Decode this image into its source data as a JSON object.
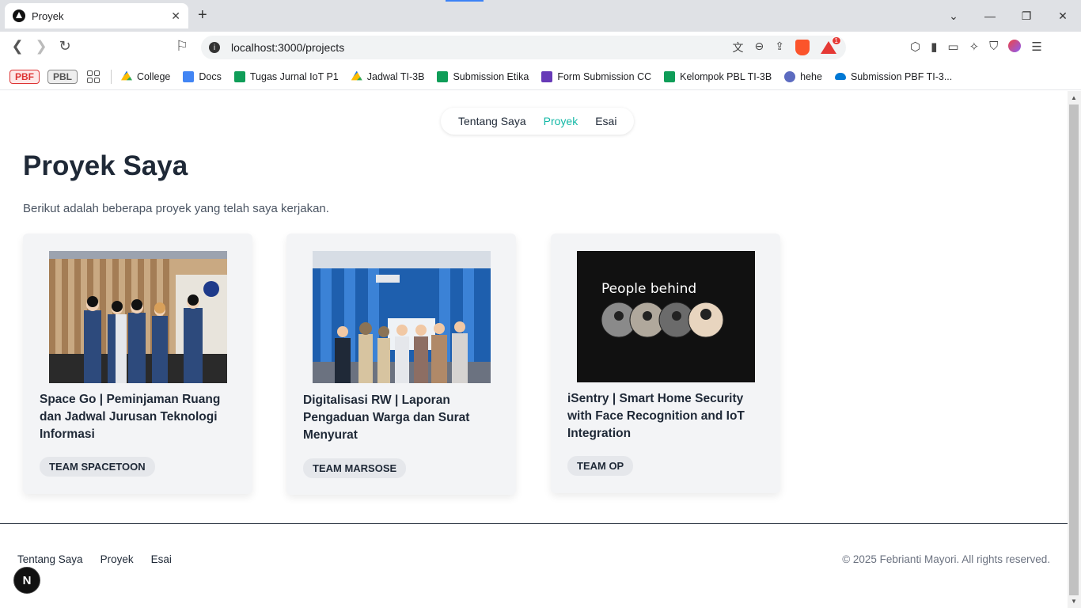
{
  "browser": {
    "tab_title": "Proyek",
    "url": "localhost:3000/projects",
    "badge_count": "1"
  },
  "bookmarks": {
    "pill1": "PBF",
    "pill2": "PBL",
    "items": [
      {
        "label": "College",
        "icon": "drive-icon"
      },
      {
        "label": "Docs",
        "icon": "docs-icon"
      },
      {
        "label": "Tugas Jurnal IoT P1",
        "icon": "sheets-icon"
      },
      {
        "label": "Jadwal TI-3B",
        "icon": "drive-icon"
      },
      {
        "label": "Submission Etika",
        "icon": "sheets-icon"
      },
      {
        "label": "Form Submission CC",
        "icon": "forms-icon"
      },
      {
        "label": "Kelompok PBL TI-3B",
        "icon": "sheets-icon"
      },
      {
        "label": "hehe",
        "icon": "hehe-icon"
      },
      {
        "label": "Submission PBF TI-3...",
        "icon": "cloud-icon"
      }
    ]
  },
  "nav": {
    "items": [
      "Tentang Saya",
      "Proyek",
      "Esai"
    ],
    "active": "Proyek",
    "active_color": "#14b8a6"
  },
  "page": {
    "title": "Proyek Saya",
    "lead": "Berikut adalah beberapa proyek yang telah saya kerjakan."
  },
  "projects": [
    {
      "title": "Space Go | Peminjaman Ruang dan Jadwal Jurusan Teknologi Informasi",
      "team": "TEAM SPACETOON"
    },
    {
      "title": "Digitalisasi RW | Laporan Pengaduan Warga dan Surat Menyurat",
      "team": "TEAM MARSOSE"
    },
    {
      "title": "iSentry | Smart Home Security with Face Recognition and IoT Integration",
      "team": "TEAM OP",
      "image_caption": "People behind"
    }
  ],
  "footer": {
    "links": [
      "Tentang Saya",
      "Proyek",
      "Esai"
    ],
    "copyright": "© 2025 Febrianti Mayori. All rights reserved."
  },
  "next_badge": "N"
}
